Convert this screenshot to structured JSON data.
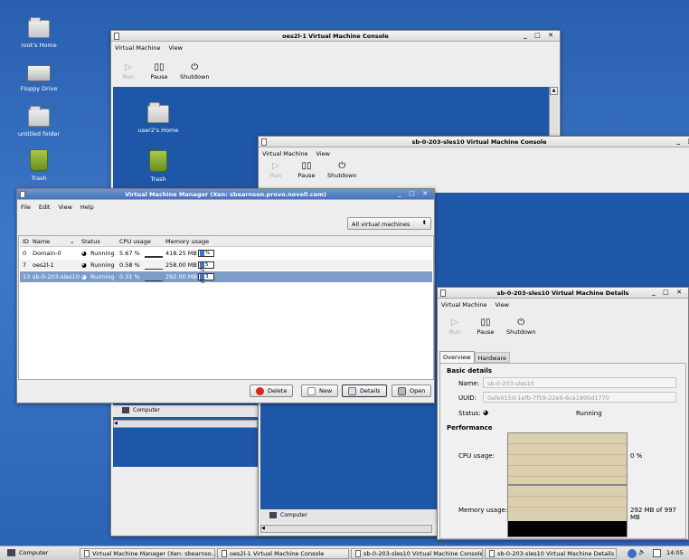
{
  "desktop_icons": [
    {
      "label": "root's Home",
      "icon": "home-folder-icon"
    },
    {
      "label": "Floppy Drive",
      "icon": "floppy-drive-icon"
    },
    {
      "label": "untitled folder",
      "icon": "folder-icon"
    },
    {
      "label": "Trash",
      "icon": "trash-icon"
    }
  ],
  "console1": {
    "title": "oes2l-1 Virtual Machine Console",
    "menu": [
      "Virtual Machine",
      "View"
    ],
    "toolbar": {
      "run": "Run",
      "pause": "Pause",
      "shutdown": "Shutdown"
    },
    "guest_icons": [
      {
        "label": "user2's Home"
      },
      {
        "label": "Trash"
      }
    ],
    "guest_taskbar": "Computer"
  },
  "console2": {
    "title": "sb-0-203-sles10 Virtual Machine Console",
    "menu": [
      "Virtual Machine",
      "View"
    ],
    "toolbar": {
      "run": "Run",
      "pause": "Pause",
      "shutdown": "Shutdown"
    },
    "guest_taskbar": "Computer"
  },
  "manager": {
    "title": "Virtual Machine Manager (Xen: sbearnson.provo.novell.com)",
    "menu": [
      "File",
      "Edit",
      "View",
      "Help"
    ],
    "filter_value": "All virtual machines",
    "columns": [
      "ID",
      "Name",
      "Status",
      "CPU usage",
      "Memory usage"
    ],
    "rows": [
      {
        "id": "0",
        "name": "Domain-0",
        "status": "Running",
        "cpu": "5.67 %",
        "mem": "418.25 MB",
        "mem_pct": "%"
      },
      {
        "id": "7",
        "name": "oes2l-1",
        "status": "Running",
        "cpu": "0.58 %",
        "mem": "258.00 MB",
        "mem_pct": "5 %"
      },
      {
        "id": "13",
        "name": "sb-0-203-sles10",
        "status": "Running",
        "cpu": "0.31 %",
        "mem": "292.00 MB",
        "mem_pct": "3 %"
      }
    ],
    "buttons": {
      "delete": "Delete",
      "new": "New",
      "details": "Details",
      "open": "Open"
    }
  },
  "details": {
    "title": "sb-0-203-sles10 Virtual Machine Details",
    "menu": [
      "Virtual Machine",
      "View"
    ],
    "toolbar": {
      "run": "Run",
      "pause": "Pause",
      "shutdown": "Shutdown"
    },
    "tabs": [
      "Overview",
      "Hardware"
    ],
    "basic_heading": "Basic details",
    "name_label": "Name:",
    "name_value": "sb-0-203-sles10",
    "uuid_label": "UUID:",
    "uuid_value": "0afe615d-1efb-7f59-22e6-6ca189bd1770",
    "status_label": "Status:",
    "status_value": "Running",
    "perf_heading": "Performance",
    "cpu_label": "CPU usage:",
    "cpu_value": "0 %",
    "mem_label": "Memory usage:",
    "mem_value": "292 MB of 997 MB"
  },
  "taskbar": {
    "computer": "Computer",
    "tasks": [
      "Virtual Machine Manager (Xen: sbearnso...",
      "oes2l-1 Virtual Machine Console",
      "sb-0-203-sles10 Virtual Machine Console",
      "sb-0-203-sles10 Virtual Machine Details"
    ],
    "clock": "14:05"
  }
}
